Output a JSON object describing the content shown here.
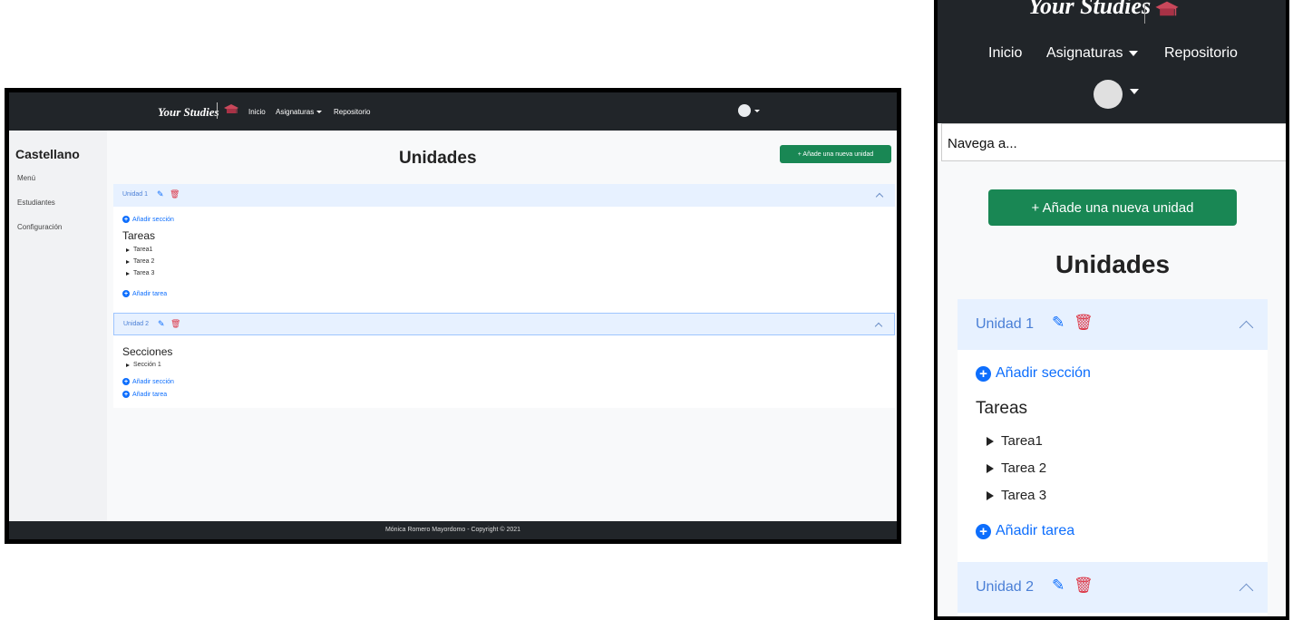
{
  "brand": {
    "name": "Your Studies"
  },
  "nav": {
    "items": [
      "Inicio",
      "Asignaturas",
      "Repositorio"
    ]
  },
  "sidebar": {
    "title": "Castellano",
    "items": [
      "Menú",
      "Estudiantes",
      "Configuración"
    ]
  },
  "mobile": {
    "navega_placeholder": "Navega a..."
  },
  "main": {
    "title": "Unidades",
    "add_unit_desktop": "+ Añade una nueva unidad",
    "add_unit_mobile": "+ Añade una nueva unidad"
  },
  "units": [
    {
      "label": "Unidad 1",
      "add_section": "Añadir sección",
      "section_title": "Tareas",
      "items": [
        "Tarea1",
        "Tarea 2",
        "Tarea 3"
      ],
      "add_task": "Añadir tarea"
    },
    {
      "label": "Unidad 2",
      "section_title": "Secciones",
      "items": [
        "Sección 1"
      ],
      "add_section": "Añadir sección",
      "add_task": "Añadir tarea"
    }
  ],
  "footer": {
    "text": "Mónica Romero Mayordomo - Copyright © 2021"
  },
  "colors": {
    "navbar": "#212529",
    "success": "#198754",
    "primary": "#0d6efd",
    "danger": "#dc3545",
    "accordion_head": "#e7f1ff"
  }
}
